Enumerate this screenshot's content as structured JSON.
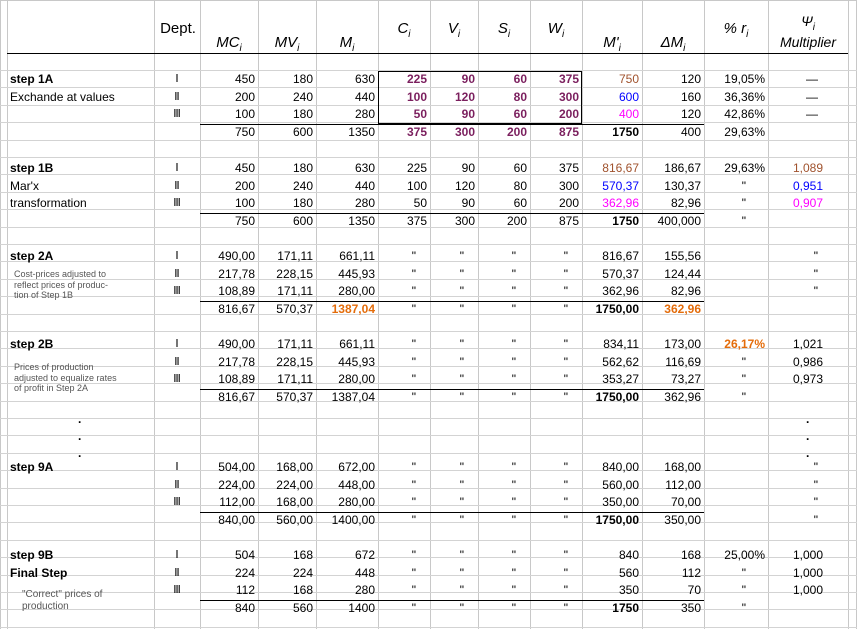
{
  "headers": {
    "dept": "Dept.",
    "mc": "MC",
    "mv": "MV",
    "m": "M",
    "c": "C",
    "v": "V",
    "s": "S",
    "w": "W",
    "mprime": "M'",
    "dm": "ΔM",
    "r": "% r",
    "psi": "Ψ",
    "psi_label": "Multiplier",
    "sub": "i"
  },
  "colors": {
    "purple": "#7b1f5e",
    "brown": "#a0522d",
    "blue": "#0000ff",
    "magenta": "#ff00ff",
    "orange": "#e46c0a"
  },
  "notes": {
    "n2a": [
      "Cost-prices adjusted to",
      "reflect prices of produc-",
      "tion of Step 1B"
    ],
    "n2b": [
      "Prices of production",
      "adjusted to equalize rates",
      "of profit in Step 2A"
    ],
    "n9b": [
      "\"Correct\" prices of",
      "production"
    ]
  },
  "dots": ".",
  "ditto": "\"",
  "dash": "—",
  "rows": [
    {
      "label": "step 1A",
      "bold": true,
      "dept": "Ⅰ",
      "mc": "450",
      "mv": "180",
      "m": "630",
      "c": "225",
      "v": "90",
      "s": "60",
      "w": "375",
      "mp": "750",
      "dm": "120",
      "r": "19,05%",
      "psi": "—"
    },
    {
      "label": "Exchande at values",
      "dept": "Ⅱ",
      "mc": "200",
      "mv": "240",
      "m": "440",
      "c": "100",
      "v": "120",
      "s": "80",
      "w": "300",
      "mp": "600",
      "dm": "160",
      "r": "36,36%",
      "psi": "—"
    },
    {
      "label": "",
      "dept": "Ⅲ",
      "mc": "100",
      "mv": "180",
      "m": "280",
      "c": "50",
      "v": "90",
      "s": "60",
      "w": "200",
      "mp": "400",
      "dm": "120",
      "r": "42,86%",
      "psi": "—"
    },
    {
      "label": "",
      "dept": "",
      "mc": "750",
      "mv": "600",
      "m": "1350",
      "c": "375",
      "v": "300",
      "s": "200",
      "w": "875",
      "mp": "1750",
      "dm": "400",
      "r": "29,63%",
      "psi": ""
    },
    {
      "label": "step 1B",
      "bold": true,
      "dept": "Ⅰ",
      "mc": "450",
      "mv": "180",
      "m": "630",
      "c": "225",
      "v": "90",
      "s": "60",
      "w": "375",
      "mp": "816,67",
      "dm": "186,67",
      "r": "29,63%",
      "psi": "1,089"
    },
    {
      "label": "Mar'x",
      "dept": "Ⅱ",
      "mc": "200",
      "mv": "240",
      "m": "440",
      "c": "100",
      "v": "120",
      "s": "80",
      "w": "300",
      "mp": "570,37",
      "dm": "130,37",
      "r": "\"",
      "psi": "0,951"
    },
    {
      "label": "transformation",
      "dept": "Ⅲ",
      "mc": "100",
      "mv": "180",
      "m": "280",
      "c": "50",
      "v": "90",
      "s": "60",
      "w": "200",
      "mp": "362,96",
      "dm": "82,96",
      "r": "\"",
      "psi": "0,907"
    },
    {
      "label": "",
      "dept": "",
      "mc": "750",
      "mv": "600",
      "m": "1350",
      "c": "375",
      "v": "300",
      "s": "200",
      "w": "875",
      "mp": "1750",
      "dm": "400,000",
      "r": "\"",
      "psi": ""
    },
    {
      "label": "step 2A",
      "bold": true,
      "dept": "Ⅰ",
      "mc": "490,00",
      "mv": "171,11",
      "m": "661,11",
      "c": "\"",
      "v": "\"",
      "s": "\"",
      "w": "\"",
      "mp": "816,67",
      "dm": "155,56",
      "r": "",
      "psi": "\""
    },
    {
      "label": "",
      "dept": "Ⅱ",
      "mc": "217,78",
      "mv": "228,15",
      "m": "445,93",
      "c": "\"",
      "v": "\"",
      "s": "\"",
      "w": "\"",
      "mp": "570,37",
      "dm": "124,44",
      "r": "",
      "psi": "\""
    },
    {
      "label": "",
      "dept": "Ⅲ",
      "mc": "108,89",
      "mv": "171,11",
      "m": "280,00",
      "c": "\"",
      "v": "\"",
      "s": "\"",
      "w": "\"",
      "mp": "362,96",
      "dm": "82,96",
      "r": "",
      "psi": "\""
    },
    {
      "label": "",
      "dept": "",
      "mc": "816,67",
      "mv": "570,37",
      "m": "1387,04",
      "c": "\"",
      "v": "\"",
      "s": "\"",
      "w": "\"",
      "mp": "1750,00",
      "dm": "362,96",
      "r": "",
      "psi": ""
    },
    {
      "label": "step 2B",
      "bold": true,
      "dept": "Ⅰ",
      "mc": "490,00",
      "mv": "171,11",
      "m": "661,11",
      "c": "\"",
      "v": "\"",
      "s": "\"",
      "w": "\"",
      "mp": "834,11",
      "dm": "173,00",
      "r": "26,17%",
      "psi": "1,021"
    },
    {
      "label": "",
      "dept": "Ⅱ",
      "mc": "217,78",
      "mv": "228,15",
      "m": "445,93",
      "c": "\"",
      "v": "\"",
      "s": "\"",
      "w": "\"",
      "mp": "562,62",
      "dm": "116,69",
      "r": "\"",
      "psi": "0,986"
    },
    {
      "label": "",
      "dept": "Ⅲ",
      "mc": "108,89",
      "mv": "171,11",
      "m": "280,00",
      "c": "\"",
      "v": "\"",
      "s": "\"",
      "w": "\"",
      "mp": "353,27",
      "dm": "73,27",
      "r": "\"",
      "psi": "0,973"
    },
    {
      "label": "",
      "dept": "",
      "mc": "816,67",
      "mv": "570,37",
      "m": "1387,04",
      "c": "\"",
      "v": "\"",
      "s": "\"",
      "w": "\"",
      "mp": "1750,00",
      "dm": "362,96",
      "r": "\"",
      "psi": ""
    },
    {
      "label": "step 9A",
      "bold": true,
      "dept": "Ⅰ",
      "mc": "504,00",
      "mv": "168,00",
      "m": "672,00",
      "c": "\"",
      "v": "\"",
      "s": "\"",
      "w": "\"",
      "mp": "840,00",
      "dm": "168,00",
      "r": "",
      "psi": "\""
    },
    {
      "label": "",
      "dept": "Ⅱ",
      "mc": "224,00",
      "mv": "224,00",
      "m": "448,00",
      "c": "\"",
      "v": "\"",
      "s": "\"",
      "w": "\"",
      "mp": "560,00",
      "dm": "112,00",
      "r": "",
      "psi": "\""
    },
    {
      "label": "",
      "dept": "Ⅲ",
      "mc": "112,00",
      "mv": "168,00",
      "m": "280,00",
      "c": "\"",
      "v": "\"",
      "s": "\"",
      "w": "\"",
      "mp": "350,00",
      "dm": "70,00",
      "r": "",
      "psi": "\""
    },
    {
      "label": "",
      "dept": "",
      "mc": "840,00",
      "mv": "560,00",
      "m": "1400,00",
      "c": "\"",
      "v": "\"",
      "s": "\"",
      "w": "\"",
      "mp": "1750,00",
      "dm": "350,00",
      "r": "",
      "psi": "\""
    },
    {
      "label": "step 9B",
      "bold": true,
      "dept": "Ⅰ",
      "mc": "504",
      "mv": "168",
      "m": "672",
      "c": "\"",
      "v": "\"",
      "s": "\"",
      "w": "\"",
      "mp": "840",
      "dm": "168",
      "r": "25,00%",
      "psi": "1,000"
    },
    {
      "label": "Final Step",
      "bold": true,
      "dept": "Ⅱ",
      "mc": "224",
      "mv": "224",
      "m": "448",
      "c": "\"",
      "v": "\"",
      "s": "\"",
      "w": "\"",
      "mp": "560",
      "dm": "112",
      "r": "\"",
      "psi": "1,000"
    },
    {
      "label": "",
      "dept": "Ⅲ",
      "mc": "112",
      "mv": "168",
      "m": "280",
      "c": "\"",
      "v": "\"",
      "s": "\"",
      "w": "\"",
      "mp": "350",
      "dm": "70",
      "r": "\"",
      "psi": "1,000"
    },
    {
      "label": "",
      "dept": "",
      "mc": "840",
      "mv": "560",
      "m": "1400",
      "c": "\"",
      "v": "\"",
      "s": "\"",
      "w": "\"",
      "mp": "1750",
      "dm": "350",
      "r": "\"",
      "psi": ""
    }
  ]
}
